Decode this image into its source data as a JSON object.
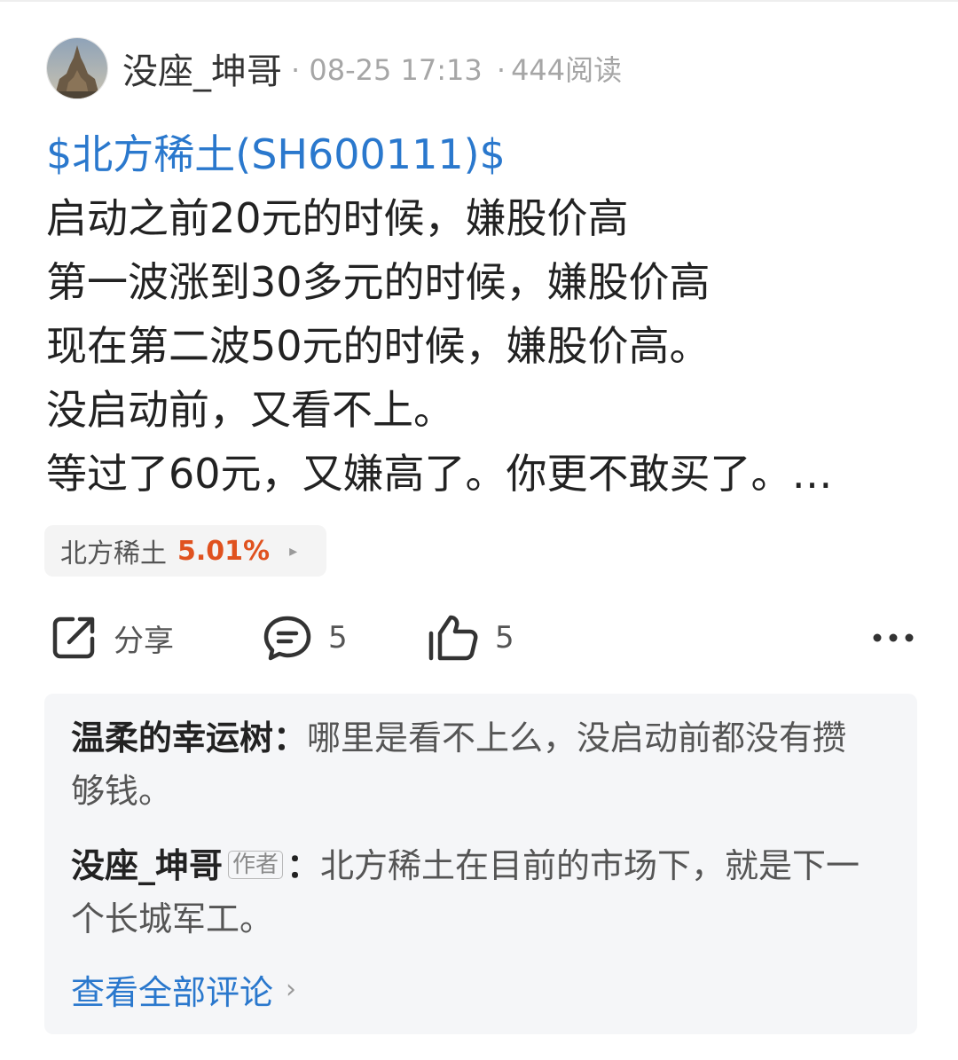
{
  "post": {
    "author": "没座_坤哥",
    "meta_date": "08-25 17:13",
    "meta_separator": "·",
    "meta_reads": "444阅读",
    "stock_link": "$北方稀土(SH600111)$",
    "lines": [
      "启动之前20元的时候，嫌股价高",
      "第一波涨到30多元的时候，嫌股价高",
      "现在第二波50元的时候，嫌股价高。",
      "没启动前，又看不上。",
      "等过了60元，又嫌高了。你更不敢买了。…"
    ]
  },
  "stock_chip": {
    "name": "北方稀土",
    "change": "5.01%",
    "arrow": "▸",
    "change_color": "#e0521f"
  },
  "actions": {
    "share_label": "分享",
    "comment_count": "5",
    "like_count": "5",
    "icons": [
      "share-icon",
      "comment-icon",
      "like-icon",
      "more-icon"
    ]
  },
  "comments": {
    "items": [
      {
        "author": "温柔的幸运树",
        "colon": "：",
        "text": "哪里是看不上么，没启动前都没有攒够钱。"
      },
      {
        "author": "没座_坤哥",
        "tag": "作者",
        "colon": "：",
        "text": "北方稀土在目前的市场下，就是下一个长城军工。"
      }
    ],
    "view_all": "查看全部评论",
    "view_all_chevron": "›"
  },
  "colors": {
    "link": "#2a78cd",
    "text": "#222222",
    "muted": "#a6a6a6",
    "comment_bg": "#f5f6f8"
  }
}
